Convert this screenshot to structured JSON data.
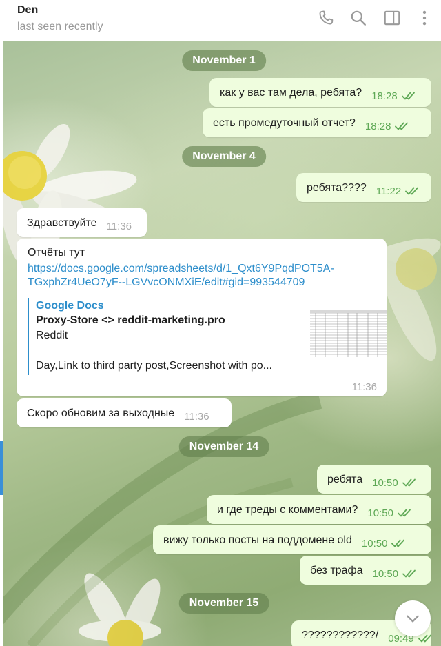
{
  "header": {
    "name": "Den",
    "status": "last seen recently",
    "icons": [
      "phone-icon",
      "search-icon",
      "side-panel-icon",
      "more-vertical-icon"
    ]
  },
  "colors": {
    "outgoing_bubble": "#effdde",
    "incoming_bubble": "#ffffff",
    "link": "#2d8ecb",
    "read_checks": "#5ea855",
    "date_pill": "#62804e"
  },
  "dates": [
    "November 1",
    "November 4",
    "November 14",
    "November 15"
  ],
  "messages": [
    {
      "text": "как у вас там дела, ребята?",
      "time": "18:28"
    },
    {
      "text": "есть промедуточный отчет?",
      "time": "18:28"
    },
    {
      "text": "ребята????",
      "time": "11:22"
    },
    {
      "text": "Здравствуйте",
      "time": "11:36"
    },
    {
      "text": "Скоро обновим за выходные",
      "time": "11:36"
    },
    {
      "text": "ребята",
      "time": "10:50"
    },
    {
      "text": "и где треды с комментами?",
      "time": "10:50"
    },
    {
      "text": "вижу только посты на поддомене old",
      "time": "10:50"
    },
    {
      "text": "без трафа",
      "time": "10:50"
    },
    {
      "text": "????????????/",
      "time": "09:49"
    }
  ],
  "link_message": {
    "text": "Отчёты тут",
    "url_line1": "https://docs.google.com/spreadsheets/d/1_Qxt6Y9PqdPOT5A-",
    "url_line2": "TGxphZr4UeO7yF--LGVvcONMXiE/edit#gid=993544709",
    "preview_site": "Google Docs",
    "preview_title": "Proxy-Store <> reddit-marketing.pro",
    "preview_desc1": "Reddit",
    "preview_desc2": "Day,Link to third party post,Screenshot with po...",
    "time": "11:36"
  }
}
